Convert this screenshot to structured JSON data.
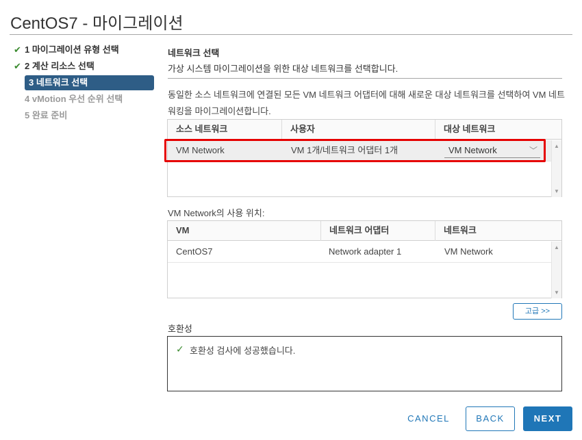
{
  "window": {
    "title": "CentOS7 - 마이그레이션"
  },
  "steps": [
    {
      "label": "1 마이그레이션 유형 선택",
      "state": "done"
    },
    {
      "label": "2 계산 리소스 선택",
      "state": "done"
    },
    {
      "label": "3 네트워크 선택",
      "state": "active"
    },
    {
      "label": "4 vMotion 우선 순위 선택",
      "state": "pending"
    },
    {
      "label": "5 완료 준비",
      "state": "pending"
    }
  ],
  "main": {
    "section_title": "네트워크 선택",
    "section_subtitle": "가상 시스템 마이그레이션을 위한 대상 네트워크를 선택합니다.",
    "description": "동일한 소스 네트워크에 연결된 모든 VM 네트워크 어댑터에 대해 새로운 대상 네트워크를 선택하여 VM 네트워킹을 마이그레이션합니다."
  },
  "network_grid": {
    "columns": [
      "소스 네트워크",
      "사용자",
      "대상 네트워크"
    ],
    "rows": [
      {
        "source": "VM Network",
        "users": "VM 1개/네트워크 어댑터 1개",
        "destination": "VM Network"
      }
    ]
  },
  "usage": {
    "label": "VM Network의 사용 위치:",
    "columns": [
      "VM",
      "네트워크 어댑터",
      "네트워크"
    ],
    "rows": [
      {
        "vm": "CentOS7",
        "adapter": "Network adapter 1",
        "network": "VM Network"
      }
    ]
  },
  "advanced_button": "고급 >>",
  "compatibility": {
    "label": "호환성",
    "message": "호환성 검사에 성공했습니다."
  },
  "footer": {
    "cancel": "CANCEL",
    "back": "BACK",
    "next": "NEXT"
  },
  "colors": {
    "accent": "#1f76b7",
    "active_step": "#2e5d86",
    "success": "#3a8a2e",
    "highlight": "#e60000"
  },
  "icons": [
    "check-icon",
    "chevron-down-icon",
    "scroll-up-icon",
    "scroll-down-icon"
  ]
}
